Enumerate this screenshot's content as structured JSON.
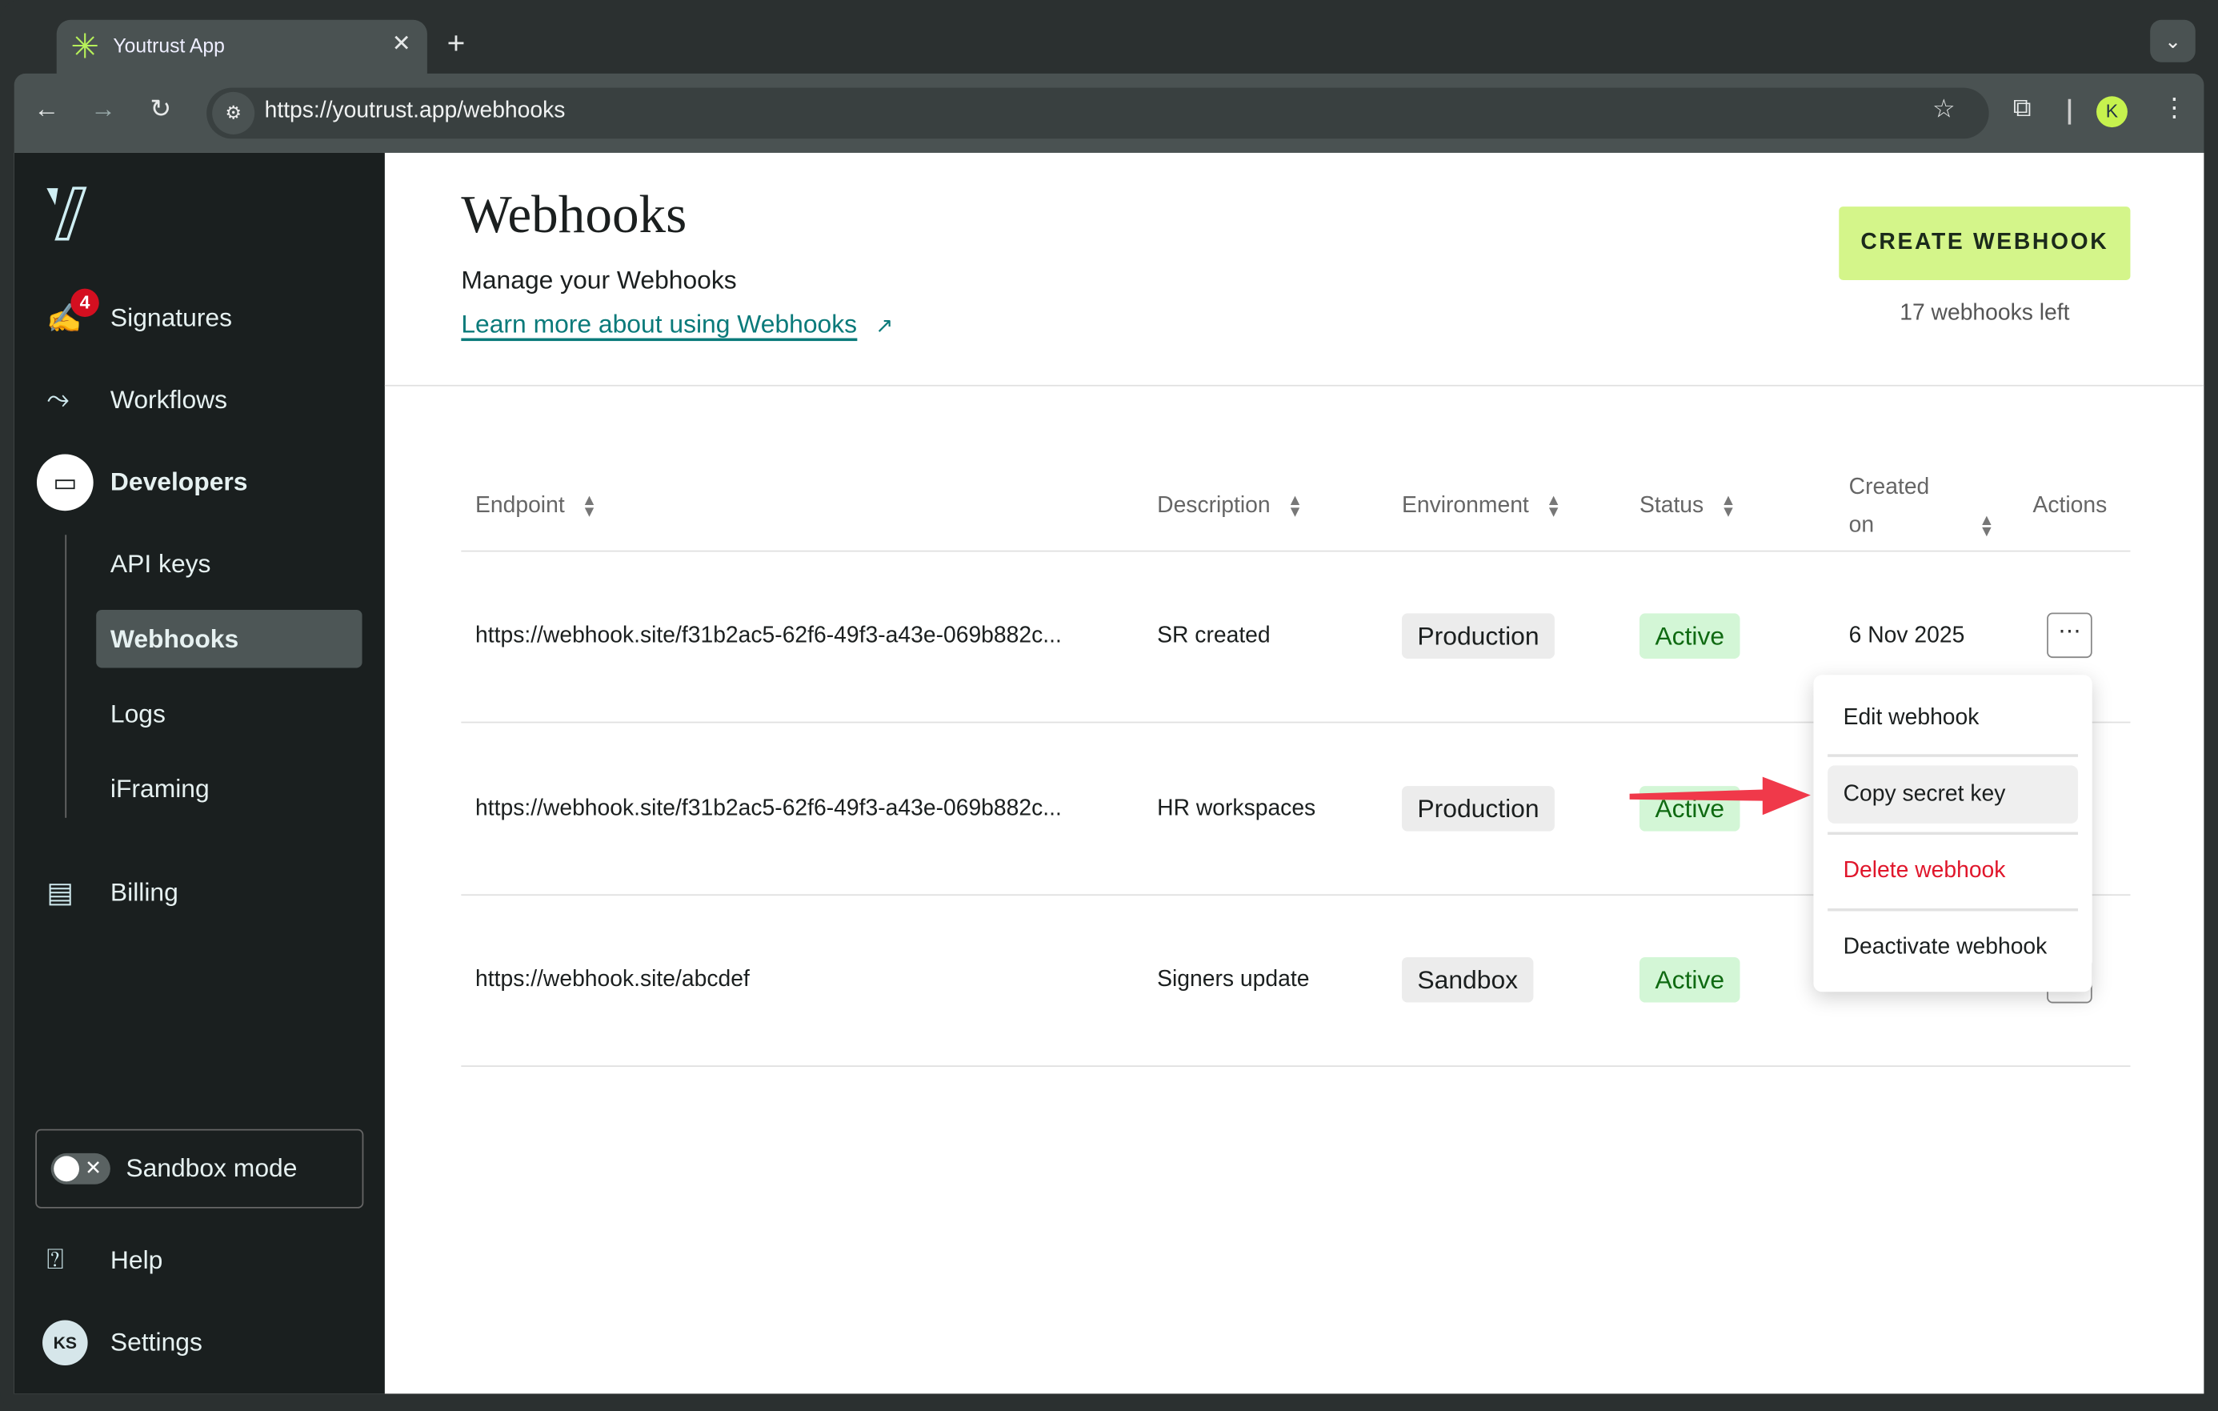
{
  "browser": {
    "tab_title": "Youtrust App",
    "url": "https://youtrust.app/webhooks",
    "profile_initial": "K",
    "accent": "#c6f24e"
  },
  "sidebar": {
    "items": [
      {
        "label": "Signatures",
        "icon": "signature-icon",
        "badge": "4"
      },
      {
        "label": "Workflows",
        "icon": "workflow-icon"
      },
      {
        "label": "Developers",
        "icon": "developers-icon"
      },
      {
        "label": "Billing",
        "icon": "billing-icon"
      }
    ],
    "sub_items": [
      {
        "label": "API keys"
      },
      {
        "label": "Webhooks",
        "active": true
      },
      {
        "label": "Logs"
      },
      {
        "label": "iFraming"
      }
    ],
    "sandbox_label": "Sandbox mode",
    "sandbox_enabled": false,
    "help_label": "Help",
    "settings_label": "Settings",
    "avatar_initials": "KS"
  },
  "header": {
    "title": "Webhooks",
    "subtitle": "Manage your Webhooks",
    "learn_link": "Learn more about using Webhooks",
    "create_button": "CREATE WEBHOOK",
    "remaining": "17 webhooks left"
  },
  "table": {
    "columns": [
      "Endpoint",
      "Description",
      "Environment",
      "Status",
      "Created on",
      "Actions"
    ],
    "rows": [
      {
        "endpoint": "https://webhook.site/f31b2ac5-62f6-49f3-a43e-069b882c...",
        "description": "SR created",
        "environment": "Production",
        "status": "Active",
        "created": "6 Nov 2025"
      },
      {
        "endpoint": "https://webhook.site/f31b2ac5-62f6-49f3-a43e-069b882c...",
        "description": "HR workspaces",
        "environment": "Production",
        "status": "Active"
      },
      {
        "endpoint": "https://webhook.site/abcdef",
        "description": "Signers update",
        "environment": "Sandbox",
        "status": "Active"
      }
    ]
  },
  "menu": {
    "items": [
      "Edit webhook",
      "Copy secret key",
      "Delete webhook",
      "Deactivate webhook"
    ],
    "highlighted": "Copy secret key",
    "danger_color": "#e0162b"
  },
  "annotation": {
    "arrow_color": "#f0394a"
  }
}
